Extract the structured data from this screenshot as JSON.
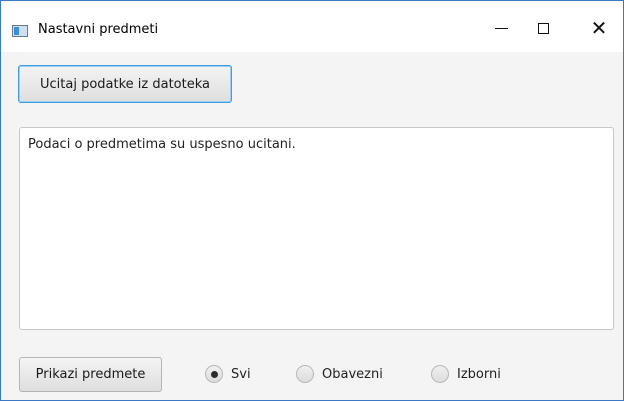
{
  "window": {
    "title": "Nastavni predmeti",
    "icon": "java-app-icon",
    "controls": {
      "minimize": "minimize-icon",
      "maximize": "maximize-icon",
      "close": "close-icon"
    }
  },
  "toolbar": {
    "load_label": "Ucitaj podatke iz datoteka"
  },
  "output": {
    "text": "Podaci o predmetima su uspesno ucitani."
  },
  "filter": {
    "show_label": "Prikazi predmete",
    "options": [
      {
        "label": "Svi",
        "selected": true
      },
      {
        "label": "Obavezni",
        "selected": false
      },
      {
        "label": "Izborni",
        "selected": false
      }
    ]
  },
  "colors": {
    "focus_border": "#3f9ee0",
    "window_border": "#3c78c4",
    "background": "#f4f4f4"
  }
}
